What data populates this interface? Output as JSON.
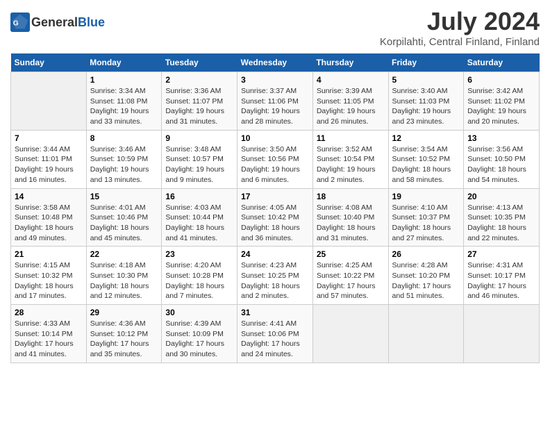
{
  "header": {
    "logo_general": "General",
    "logo_blue": "Blue",
    "title": "July 2024",
    "subtitle": "Korpilahti, Central Finland, Finland"
  },
  "calendar": {
    "weekdays": [
      "Sunday",
      "Monday",
      "Tuesday",
      "Wednesday",
      "Thursday",
      "Friday",
      "Saturday"
    ],
    "weeks": [
      [
        {
          "day": "",
          "info": ""
        },
        {
          "day": "1",
          "info": "Sunrise: 3:34 AM\nSunset: 11:08 PM\nDaylight: 19 hours\nand 33 minutes."
        },
        {
          "day": "2",
          "info": "Sunrise: 3:36 AM\nSunset: 11:07 PM\nDaylight: 19 hours\nand 31 minutes."
        },
        {
          "day": "3",
          "info": "Sunrise: 3:37 AM\nSunset: 11:06 PM\nDaylight: 19 hours\nand 28 minutes."
        },
        {
          "day": "4",
          "info": "Sunrise: 3:39 AM\nSunset: 11:05 PM\nDaylight: 19 hours\nand 26 minutes."
        },
        {
          "day": "5",
          "info": "Sunrise: 3:40 AM\nSunset: 11:03 PM\nDaylight: 19 hours\nand 23 minutes."
        },
        {
          "day": "6",
          "info": "Sunrise: 3:42 AM\nSunset: 11:02 PM\nDaylight: 19 hours\nand 20 minutes."
        }
      ],
      [
        {
          "day": "7",
          "info": "Sunrise: 3:44 AM\nSunset: 11:01 PM\nDaylight: 19 hours\nand 16 minutes."
        },
        {
          "day": "8",
          "info": "Sunrise: 3:46 AM\nSunset: 10:59 PM\nDaylight: 19 hours\nand 13 minutes."
        },
        {
          "day": "9",
          "info": "Sunrise: 3:48 AM\nSunset: 10:57 PM\nDaylight: 19 hours\nand 9 minutes."
        },
        {
          "day": "10",
          "info": "Sunrise: 3:50 AM\nSunset: 10:56 PM\nDaylight: 19 hours\nand 6 minutes."
        },
        {
          "day": "11",
          "info": "Sunrise: 3:52 AM\nSunset: 10:54 PM\nDaylight: 19 hours\nand 2 minutes."
        },
        {
          "day": "12",
          "info": "Sunrise: 3:54 AM\nSunset: 10:52 PM\nDaylight: 18 hours\nand 58 minutes."
        },
        {
          "day": "13",
          "info": "Sunrise: 3:56 AM\nSunset: 10:50 PM\nDaylight: 18 hours\nand 54 minutes."
        }
      ],
      [
        {
          "day": "14",
          "info": "Sunrise: 3:58 AM\nSunset: 10:48 PM\nDaylight: 18 hours\nand 49 minutes."
        },
        {
          "day": "15",
          "info": "Sunrise: 4:01 AM\nSunset: 10:46 PM\nDaylight: 18 hours\nand 45 minutes."
        },
        {
          "day": "16",
          "info": "Sunrise: 4:03 AM\nSunset: 10:44 PM\nDaylight: 18 hours\nand 41 minutes."
        },
        {
          "day": "17",
          "info": "Sunrise: 4:05 AM\nSunset: 10:42 PM\nDaylight: 18 hours\nand 36 minutes."
        },
        {
          "day": "18",
          "info": "Sunrise: 4:08 AM\nSunset: 10:40 PM\nDaylight: 18 hours\nand 31 minutes."
        },
        {
          "day": "19",
          "info": "Sunrise: 4:10 AM\nSunset: 10:37 PM\nDaylight: 18 hours\nand 27 minutes."
        },
        {
          "day": "20",
          "info": "Sunrise: 4:13 AM\nSunset: 10:35 PM\nDaylight: 18 hours\nand 22 minutes."
        }
      ],
      [
        {
          "day": "21",
          "info": "Sunrise: 4:15 AM\nSunset: 10:32 PM\nDaylight: 18 hours\nand 17 minutes."
        },
        {
          "day": "22",
          "info": "Sunrise: 4:18 AM\nSunset: 10:30 PM\nDaylight: 18 hours\nand 12 minutes."
        },
        {
          "day": "23",
          "info": "Sunrise: 4:20 AM\nSunset: 10:28 PM\nDaylight: 18 hours\nand 7 minutes."
        },
        {
          "day": "24",
          "info": "Sunrise: 4:23 AM\nSunset: 10:25 PM\nDaylight: 18 hours\nand 2 minutes."
        },
        {
          "day": "25",
          "info": "Sunrise: 4:25 AM\nSunset: 10:22 PM\nDaylight: 17 hours\nand 57 minutes."
        },
        {
          "day": "26",
          "info": "Sunrise: 4:28 AM\nSunset: 10:20 PM\nDaylight: 17 hours\nand 51 minutes."
        },
        {
          "day": "27",
          "info": "Sunrise: 4:31 AM\nSunset: 10:17 PM\nDaylight: 17 hours\nand 46 minutes."
        }
      ],
      [
        {
          "day": "28",
          "info": "Sunrise: 4:33 AM\nSunset: 10:14 PM\nDaylight: 17 hours\nand 41 minutes."
        },
        {
          "day": "29",
          "info": "Sunrise: 4:36 AM\nSunset: 10:12 PM\nDaylight: 17 hours\nand 35 minutes."
        },
        {
          "day": "30",
          "info": "Sunrise: 4:39 AM\nSunset: 10:09 PM\nDaylight: 17 hours\nand 30 minutes."
        },
        {
          "day": "31",
          "info": "Sunrise: 4:41 AM\nSunset: 10:06 PM\nDaylight: 17 hours\nand 24 minutes."
        },
        {
          "day": "",
          "info": ""
        },
        {
          "day": "",
          "info": ""
        },
        {
          "day": "",
          "info": ""
        }
      ]
    ]
  }
}
